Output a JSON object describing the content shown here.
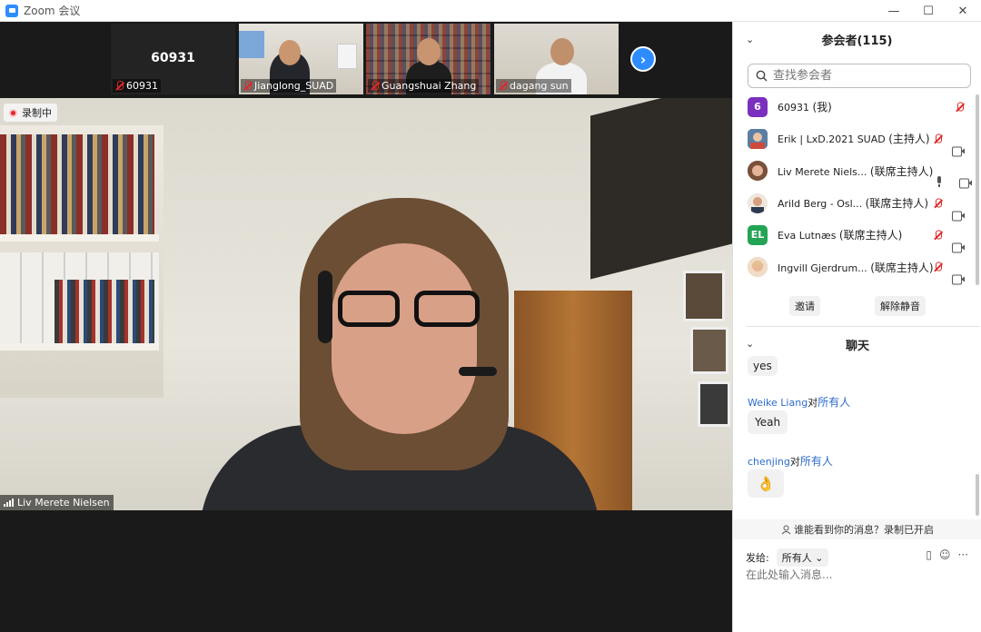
{
  "window": {
    "title": "Zoom 会议",
    "controls": [
      "—",
      "☐",
      "✕"
    ]
  },
  "thumbnails": [
    {
      "name": "60931",
      "label": "60931",
      "muted": true,
      "video": false
    },
    {
      "name": "Jianglong_SUAD",
      "muted": true,
      "video": true
    },
    {
      "name": "Guangshuai Zhang",
      "muted": true,
      "video": true
    },
    {
      "name": "dagang sun",
      "muted": true,
      "video": true
    }
  ],
  "main_video": {
    "recording_label": "录制中",
    "speaker_name": "Liv Merete Nielsen"
  },
  "participants": {
    "title": "参会者(115)",
    "search_placeholder": "查找参会者",
    "items": [
      {
        "avatar_text": "6",
        "avatar_color": "#7b2fbe",
        "name": "60931",
        "role": "(我)",
        "mic": "muted",
        "camera": false
      },
      {
        "avatar_text": "",
        "avatar_color": "#4a6a8a",
        "name": "Erik | LxD.2021 SUAD",
        "role": "(主持人)",
        "mic": "muted",
        "camera": true
      },
      {
        "avatar_text": "",
        "avatar_color": "#8a5a4a",
        "name": "Liv Merete Niels...",
        "role": "(联席主持人)",
        "mic": "on",
        "camera": true
      },
      {
        "avatar_text": "",
        "avatar_color": "#b07a5a",
        "name": "Arild Berg - Osl...",
        "role": "(联席主持人)",
        "mic": "muted",
        "camera": true
      },
      {
        "avatar_text": "EL",
        "avatar_color": "#23a455",
        "name": "Eva Lutnæs",
        "role": "(联席主持人)",
        "mic": "muted",
        "camera": true
      },
      {
        "avatar_text": "",
        "avatar_color": "#d6a98a",
        "name": "Ingvill Gjerdrum...",
        "role": "(联席主持人)",
        "mic": "muted",
        "camera": true
      }
    ],
    "invite_label": "邀请",
    "unmute_label": "解除静音"
  },
  "chat": {
    "title": "聊天",
    "messages": [
      {
        "from": "",
        "to": "",
        "text": "yes"
      },
      {
        "from": "Weike Liang",
        "dui": "对",
        "to": "所有人",
        "text": "Yeah"
      },
      {
        "from": "chenjing",
        "dui": "对",
        "to": "所有人",
        "text": "👌"
      }
    ],
    "notice": "谁能看到你的消息？录制已开启",
    "send_to_label": "发给:",
    "send_to_value": "所有人",
    "input_placeholder": "在此处输入消息..."
  }
}
